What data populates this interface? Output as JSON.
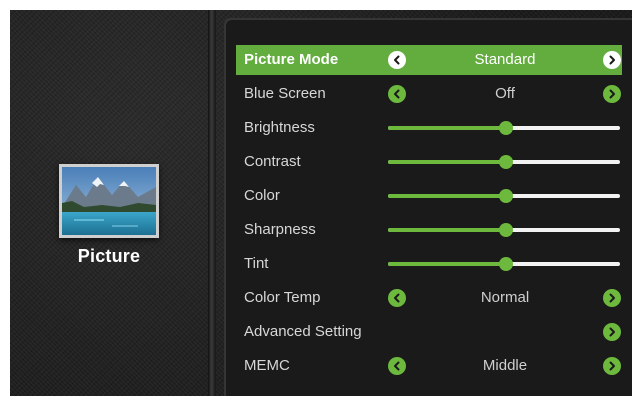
{
  "category": {
    "label": "Picture",
    "thumbnail_icon": "mountain-lake-picture-icon"
  },
  "menu": {
    "items": [
      {
        "label": "Picture Mode",
        "type": "option",
        "value": "Standard",
        "selected": true
      },
      {
        "label": "Blue Screen",
        "type": "option",
        "value": "Off"
      },
      {
        "label": "Brightness",
        "type": "slider",
        "level": 0.51
      },
      {
        "label": "Contrast",
        "type": "slider",
        "level": 0.51
      },
      {
        "label": "Color",
        "type": "slider",
        "level": 0.51
      },
      {
        "label": "Sharpness",
        "type": "slider",
        "level": 0.51
      },
      {
        "label": "Tint",
        "type": "slider",
        "level": 0.51
      },
      {
        "label": "Color Temp",
        "type": "option",
        "value": "Normal"
      },
      {
        "label": "Advanced Setting",
        "type": "submenu"
      },
      {
        "label": "MEMC",
        "type": "option",
        "value": "Middle"
      }
    ]
  },
  "icons": {
    "left": "chevron-left-icon",
    "right": "chevron-right-icon"
  },
  "colors": {
    "accent": "#63ad3f",
    "background": "#1d1d1d",
    "track": "#f2f2f2"
  }
}
